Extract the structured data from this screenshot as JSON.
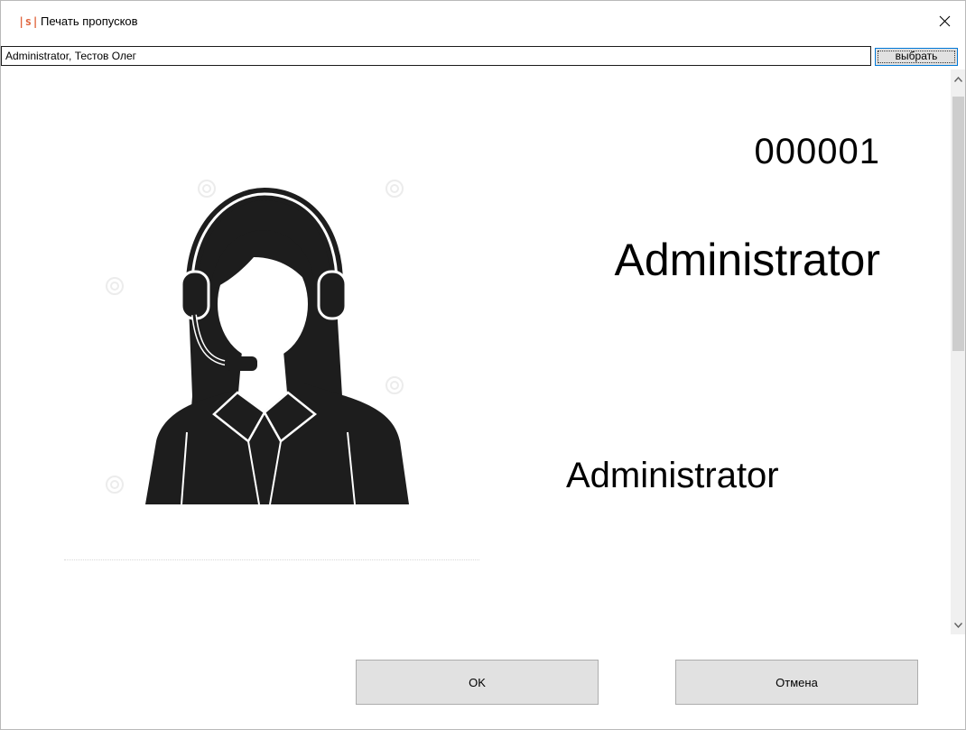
{
  "window": {
    "logo": "|s|",
    "title": "Печать пропусков",
    "close_icon": "close-icon"
  },
  "selector": {
    "value": "Administrator, Тестов Олег",
    "choose_label": "выбрать"
  },
  "card": {
    "number": "000001",
    "role": "Administrator",
    "name": "Administrator",
    "photo_icon": "operator-headset-photo"
  },
  "scrollbar": {
    "up_icon": "chevron-up-icon",
    "down_icon": "chevron-down-icon"
  },
  "buttons": {
    "ok_label": "OK",
    "cancel_label": "Отмена"
  },
  "colors": {
    "logo": "#e0643c",
    "button_bg": "#e1e1e1",
    "focus_border": "#0078d7"
  }
}
